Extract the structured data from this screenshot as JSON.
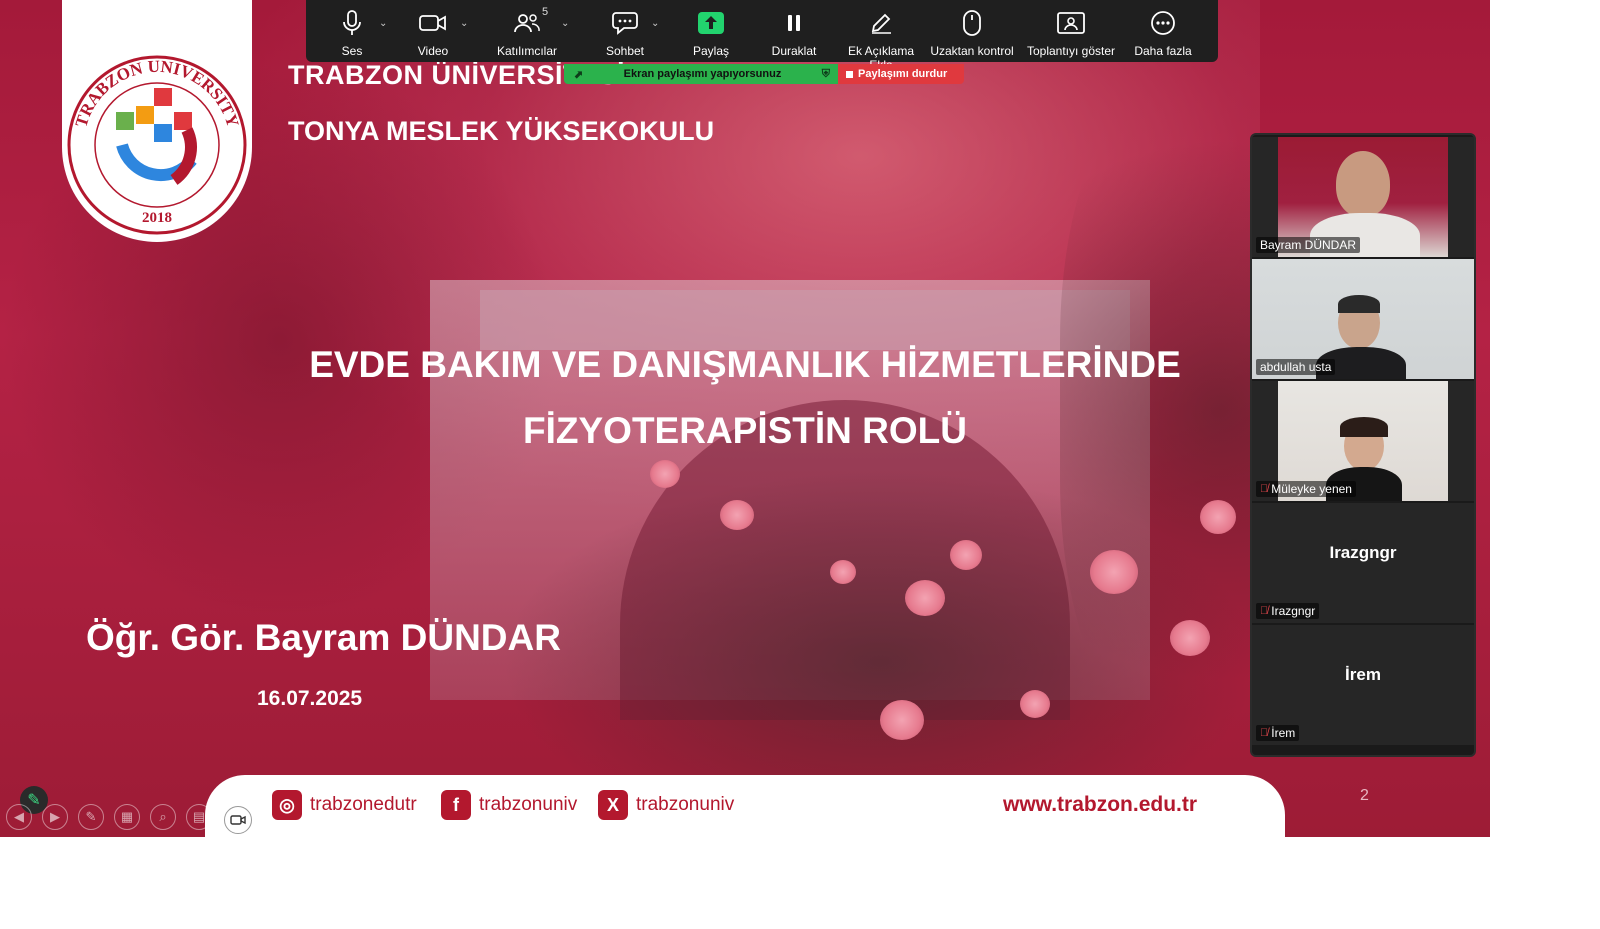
{
  "toolbar": {
    "buttons": [
      {
        "label": "Ses",
        "icon": "microphone-icon"
      },
      {
        "label": "Video",
        "icon": "video-camera-icon"
      },
      {
        "label": "Katılımcılar",
        "icon": "participants-icon"
      },
      {
        "label": "Sohbet",
        "icon": "chat-icon"
      },
      {
        "label": "Paylaş",
        "icon": "share-screen-icon"
      },
      {
        "label": "Duraklat",
        "icon": "pause-icon"
      },
      {
        "label": "Ek Açıklama Ekle",
        "icon": "annotate-pen-icon"
      },
      {
        "label": "Uzaktan kontrol",
        "icon": "mouse-icon"
      },
      {
        "label": "Toplantıyı göster",
        "icon": "show-meeting-icon"
      },
      {
        "label": "Daha fazla",
        "icon": "more-icon"
      }
    ],
    "participant_count": "5",
    "share_color": "#22d36e"
  },
  "share_banner": {
    "text": "Ekran paylaşımı yapıyorsunuz",
    "stop_label": "Paylaşımı durdur"
  },
  "slide": {
    "university": "TRABZON ÜNİVERSİTESİ",
    "school": "TONYA MESLEK YÜKSEKOKULU",
    "title_line1": "EVDE BAKIM VE DANIŞMANLIK HİZMETLERİNDE",
    "title_line2": "FİZYOTERAPİSTİN ROLÜ",
    "presenter": "Öğr. Gör. Bayram DÜNDAR",
    "date": "16.07.2025",
    "page_number": "2",
    "logo": {
      "ring_text": "TRABZON UNIVERSITY",
      "year": "2018"
    },
    "footer": {
      "instagram": "trabzonedutr",
      "facebook": "trabzonuniv",
      "x": "trabzonuniv",
      "website": "www.trabzon.edu.tr"
    },
    "brand_color": "#b3182e"
  },
  "participants": [
    {
      "name": "Bayram DÜNDAR",
      "video": true,
      "muted": false
    },
    {
      "name": "abdullah usta",
      "video": true,
      "muted": false,
      "active_speaker": true
    },
    {
      "name": "Müleyke yenen",
      "video": true,
      "muted": true
    },
    {
      "name": "Irazgngr",
      "video": false,
      "muted": true
    },
    {
      "name": "İrem",
      "video": false,
      "muted": true
    }
  ]
}
